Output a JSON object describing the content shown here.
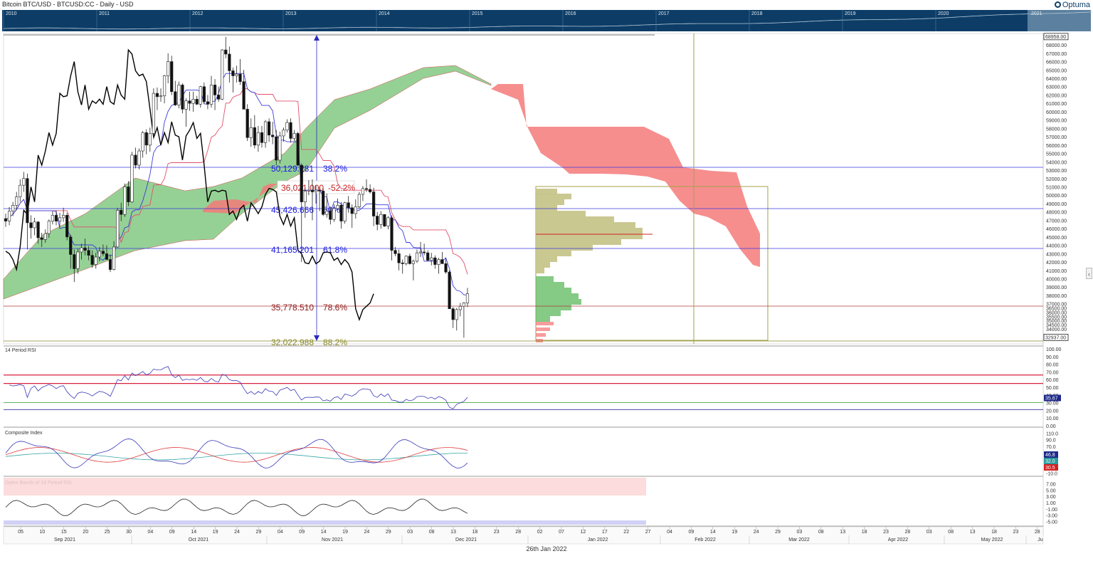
{
  "header": {
    "title": "Bitcoin BTC/USD - BTCUSD:CC - Daily - USD",
    "brand": "Optuma"
  },
  "overview": {
    "years": [
      "2010",
      "2011",
      "2012",
      "2013",
      "2014",
      "2015",
      "2016",
      "2017",
      "2018",
      "2019",
      "2020",
      "2021",
      "2022"
    ]
  },
  "chart_data": [
    {
      "type": "candlestick",
      "pane": "price",
      "yaxis_ticks": [
        "68000.00",
        "67000.00",
        "66000.00",
        "65000.00",
        "64000.00",
        "63000.00",
        "62000.00",
        "61000.00",
        "60000.00",
        "59000.00",
        "58000.00",
        "57000.00",
        "56000.00",
        "55000.00",
        "54000.00",
        "53000.00",
        "52000.00",
        "51000.00",
        "50000.00",
        "49000.00",
        "48000.00",
        "47000.00",
        "46000.00",
        "45000.00",
        "44000.00",
        "43000.00",
        "42000.00",
        "41000.00",
        "40000.00",
        "39000.00",
        "38000.00",
        "37000.00",
        "36500.00",
        "36000.00",
        "35500.00",
        "35000.00",
        "34500.00",
        "34000.00"
      ],
      "price_flags": {
        "high": "68958.00",
        "low": "32937.00"
      },
      "fibonacci": [
        {
          "value": "50,129.281",
          "pct": "38.2%"
        },
        {
          "value": "45,426.666",
          "pct": "50%"
        },
        {
          "value": "41,165.201",
          "pct": "61.8%"
        },
        {
          "value": "35,778.510",
          "pct": "78.6%"
        },
        {
          "value": "32,022.988",
          "pct": "88.2%"
        }
      ],
      "measure_label": {
        "value": "36,021.000",
        "pct": "-52.2%"
      },
      "x_ticks": [
        "05",
        "10",
        "15",
        "20",
        "25",
        "30",
        "04",
        "09",
        "14",
        "19",
        "24",
        "29",
        "04",
        "09",
        "14",
        "19",
        "24",
        "29",
        "03",
        "08",
        "13",
        "18",
        "23",
        "28",
        "02",
        "07",
        "12",
        "17",
        "22",
        "27",
        "04",
        "09",
        "14",
        "19",
        "24",
        "29",
        "03",
        "08",
        "13",
        "18",
        "23",
        "28",
        "03",
        "08",
        "13",
        "18",
        "23",
        "28"
      ],
      "months": [
        "Sep 2021",
        "Oct 2021",
        "Nov 2021",
        "Dec 2021",
        "Jan 2022",
        "Feb 2022",
        "Mar 2022",
        "Apr 2022",
        "May 2022",
        "Ju"
      ],
      "ohlc": [
        [
          47200,
          47800,
          46200,
          46900
        ],
        [
          46900,
          48600,
          46400,
          48100
        ],
        [
          48100,
          49200,
          47500,
          48800
        ],
        [
          48800,
          50400,
          48200,
          49800
        ],
        [
          49800,
          51900,
          49200,
          51200
        ],
        [
          51200,
          52800,
          50400,
          52000
        ],
        [
          52000,
          52600,
          43500,
          46700
        ],
        [
          46700,
          47600,
          44800,
          46100
        ],
        [
          46100,
          47300,
          45200,
          46800
        ],
        [
          46800,
          46900,
          44200,
          44900
        ],
        [
          44900,
          45500,
          43800,
          44700
        ],
        [
          44700,
          45900,
          44300,
          45400
        ],
        [
          45400,
          47100,
          44900,
          46900
        ],
        [
          46900,
          48100,
          46500,
          47600
        ],
        [
          47600,
          48200,
          46400,
          46900
        ],
        [
          46900,
          47900,
          46200,
          47300
        ],
        [
          47300,
          48500,
          46800,
          47600
        ],
        [
          47600,
          47900,
          44600,
          45000
        ],
        [
          45000,
          45300,
          41200,
          42900
        ],
        [
          42900,
          43500,
          39600,
          41200
        ],
        [
          41200,
          43600,
          40600,
          43200
        ],
        [
          43200,
          44200,
          42300,
          43700
        ],
        [
          43700,
          44800,
          42800,
          43400
        ],
        [
          43400,
          43900,
          42200,
          42800
        ],
        [
          42800,
          43400,
          41300,
          41700
        ],
        [
          41700,
          43100,
          41200,
          42600
        ],
        [
          42600,
          43800,
          42100,
          43300
        ],
        [
          43300,
          44100,
          42700,
          43000
        ],
        [
          43000,
          44000,
          42300,
          42300
        ],
        [
          42300,
          42900,
          40800,
          41100
        ],
        [
          41100,
          44500,
          41000,
          43800
        ],
        [
          43800,
          48500,
          43700,
          48200
        ],
        [
          48200,
          49100,
          46900,
          47700
        ],
        [
          47700,
          51400,
          47400,
          51000
        ],
        [
          51000,
          51700,
          48700,
          49200
        ],
        [
          49200,
          55200,
          49100,
          54800
        ],
        [
          54800,
          55700,
          53200,
          53600
        ],
        [
          53600,
          55600,
          53100,
          55300
        ],
        [
          55300,
          57700,
          54500,
          57500
        ],
        [
          57500,
          57900,
          54900,
          56000
        ],
        [
          56000,
          58100,
          55200,
          57400
        ],
        [
          57400,
          62800,
          56700,
          62200
        ],
        [
          62200,
          62900,
          60200,
          61800
        ],
        [
          61800,
          62800,
          61200,
          61900
        ],
        [
          61900,
          64400,
          61000,
          64300
        ],
        [
          64300,
          67000,
          63400,
          66000
        ],
        [
          66000,
          66700,
          62000,
          62400
        ],
        [
          62400,
          63700,
          60700,
          60800
        ],
        [
          60800,
          63600,
          60400,
          63200
        ],
        [
          63200,
          63400,
          59800,
          60300
        ],
        [
          60300,
          61600,
          58200,
          61300
        ],
        [
          61300,
          62400,
          60100,
          61000
        ],
        [
          61000,
          62400,
          60000,
          61500
        ],
        [
          61500,
          61900,
          60800,
          60900
        ],
        [
          60900,
          63100,
          60500,
          63000
        ],
        [
          63000,
          63500,
          60900,
          61200
        ],
        [
          61200,
          62000,
          60300,
          60900
        ],
        [
          60900,
          64300,
          60500,
          63200
        ],
        [
          63200,
          63900,
          60200,
          62000
        ],
        [
          62000,
          63000,
          61200,
          61500
        ],
        [
          61500,
          67500,
          61400,
          67400
        ],
        [
          67400,
          68958,
          66400,
          66900
        ],
        [
          66900,
          67800,
          63500,
          64900
        ],
        [
          64900,
          65300,
          62300,
          64300
        ],
        [
          64300,
          65500,
          63500,
          64500
        ],
        [
          64500,
          66300,
          63200,
          63600
        ],
        [
          63600,
          65000,
          60700,
          60300
        ],
        [
          60300,
          60900,
          56500,
          56900
        ],
        [
          56900,
          59200,
          55800,
          58100
        ],
        [
          58100,
          59600,
          55600,
          56000
        ],
        [
          56000,
          58300,
          55200,
          57500
        ],
        [
          57500,
          58300,
          55700,
          56300
        ],
        [
          56300,
          59000,
          55700,
          58800
        ],
        [
          58800,
          59200,
          56400,
          57200
        ],
        [
          57200,
          58800,
          56100,
          57000
        ],
        [
          57000,
          57800,
          53600,
          54200
        ],
        [
          54200,
          57600,
          53800,
          57100
        ],
        [
          57100,
          58100,
          56400,
          57800
        ],
        [
          57800,
          59100,
          57500,
          58700
        ],
        [
          58700,
          59200,
          56300,
          56800
        ],
        [
          56800,
          57800,
          56500,
          57400
        ],
        [
          57400,
          57600,
          53500,
          53600
        ],
        [
          53600,
          53800,
          42000,
          49200
        ],
        [
          49200,
          50800,
          47300,
          50500
        ],
        [
          50500,
          51800,
          50000,
          50600
        ],
        [
          50600,
          51900,
          47000,
          50400
        ],
        [
          50400,
          51200,
          49000,
          50600
        ],
        [
          50600,
          51000,
          48100,
          50500
        ],
        [
          50500,
          50800,
          47500,
          47700
        ],
        [
          47700,
          50200,
          47300,
          48100
        ],
        [
          48100,
          48600,
          46500,
          47100
        ],
        [
          47100,
          48900,
          46800,
          48400
        ],
        [
          48400,
          49600,
          48200,
          48800
        ],
        [
          48800,
          49200,
          46000,
          46900
        ],
        [
          46900,
          49200,
          46600,
          49100
        ],
        [
          49100,
          49900,
          47900,
          48500
        ],
        [
          48500,
          48900,
          46100,
          47800
        ],
        [
          47800,
          49500,
          47200,
          48600
        ],
        [
          48600,
          50400,
          48400,
          50100
        ],
        [
          50100,
          51100,
          49300,
          50800
        ],
        [
          50800,
          51900,
          50400,
          50700
        ],
        [
          50700,
          51300,
          50200,
          50400
        ],
        [
          50400,
          50900,
          46300,
          47500
        ],
        [
          47500,
          48000,
          45800,
          46500
        ],
        [
          46500,
          48100,
          46000,
          47700
        ],
        [
          47700,
          47700,
          46200,
          46300
        ],
        [
          46300,
          47500,
          45900,
          47300
        ],
        [
          47300,
          47600,
          42200,
          43400
        ],
        [
          43400,
          43800,
          42700,
          43000
        ],
        [
          43000,
          43500,
          41000,
          41900
        ],
        [
          41900,
          42300,
          40600,
          41800
        ],
        [
          41800,
          42800,
          41600,
          42700
        ],
        [
          42700,
          43000,
          41700,
          41800
        ],
        [
          41800,
          42300,
          39800,
          42100
        ],
        [
          42100,
          43500,
          41900,
          43100
        ],
        [
          43100,
          44400,
          42600,
          43200
        ],
        [
          43200,
          44200,
          42800,
          43100
        ],
        [
          43100,
          43400,
          42100,
          42200
        ],
        [
          42200,
          43100,
          41600,
          42500
        ],
        [
          42500,
          42800,
          41200,
          41700
        ],
        [
          41700,
          42500,
          40600,
          42300
        ],
        [
          42300,
          43200,
          41800,
          41800
        ],
        [
          41800,
          42500,
          40600,
          40800
        ],
        [
          40800,
          41000,
          38000,
          36400
        ],
        [
          36400,
          36600,
          34100,
          35100
        ],
        [
          35100,
          36500,
          33800,
          36300
        ],
        [
          36300,
          37100,
          35500,
          36700
        ],
        [
          36700,
          37200,
          32937,
          37100
        ],
        [
          37100,
          38900,
          36600,
          38200
        ]
      ],
      "kumo_green": [],
      "kumo_red": []
    },
    {
      "type": "line",
      "pane": "rsi",
      "title": "14 Period RSI",
      "yaxis_ticks": [
        "100.00",
        "90.00",
        "80.00",
        "70.00",
        "60.00",
        "50.00",
        "40.00",
        "30.00",
        "20.00",
        "10.00",
        "0.00"
      ],
      "current_value": "35.67",
      "levels": {
        "upper_red": 66,
        "lower_red": 55,
        "green": 30,
        "blue": 21
      }
    },
    {
      "type": "line",
      "pane": "composite",
      "title": "Composite Index",
      "yaxis_ticks": [
        "110.0",
        "90.0",
        "70.0",
        "50.0",
        "30.0",
        "10.0",
        "-10.0"
      ],
      "current_values": {
        "blue": "46.8",
        "teal": "32.0",
        "red": "30.5"
      }
    },
    {
      "type": "line",
      "pane": "optex",
      "title": "Optex Bands of 14 Period RSI",
      "yaxis_ticks": [
        "7.00",
        "5.00",
        "3.00",
        "1.00",
        "-1.00",
        "-3.00",
        "-5.00"
      ]
    }
  ],
  "footer": {
    "date_caption": "26th Jan 2022"
  },
  "colors": {
    "navy": "#0d3d66",
    "kumo_green": "#5cb85c",
    "kumo_red": "#f47a7a",
    "fib_blue": "#1a1adc",
    "fib_darkred": "#8b1a1a",
    "fib_olive": "#8a8a2a",
    "vp_olive": "#c4c285",
    "rsi_red": "#d8203c"
  }
}
